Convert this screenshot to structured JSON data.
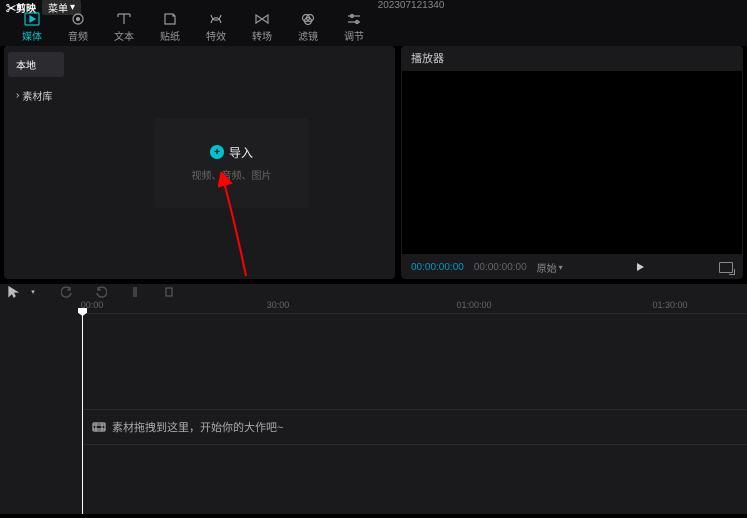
{
  "titlebar": {
    "brand": "剪映",
    "menu": "菜单",
    "project": "202307121340"
  },
  "tabs": {
    "media": "媒体",
    "audio": "音频",
    "text": "文本",
    "sticker": "贴纸",
    "effect": "特效",
    "transition": "转场",
    "filter": "滤镜",
    "adjust": "调节"
  },
  "sidebar": {
    "local": "本地",
    "library": "素材库"
  },
  "import_box": {
    "title": "导入",
    "subtitle": "视频、音频、图片"
  },
  "player": {
    "title": "播放器",
    "time_current": "00:00:00:00",
    "time_total": "00:00:00:00",
    "ratio": "原始"
  },
  "ruler": {
    "t0": "00:00",
    "t1": "30:00",
    "t2": "01:00:00",
    "t3": "01:30:00"
  },
  "timeline": {
    "hint": "素材拖拽到这里，开始你的大作吧~"
  }
}
